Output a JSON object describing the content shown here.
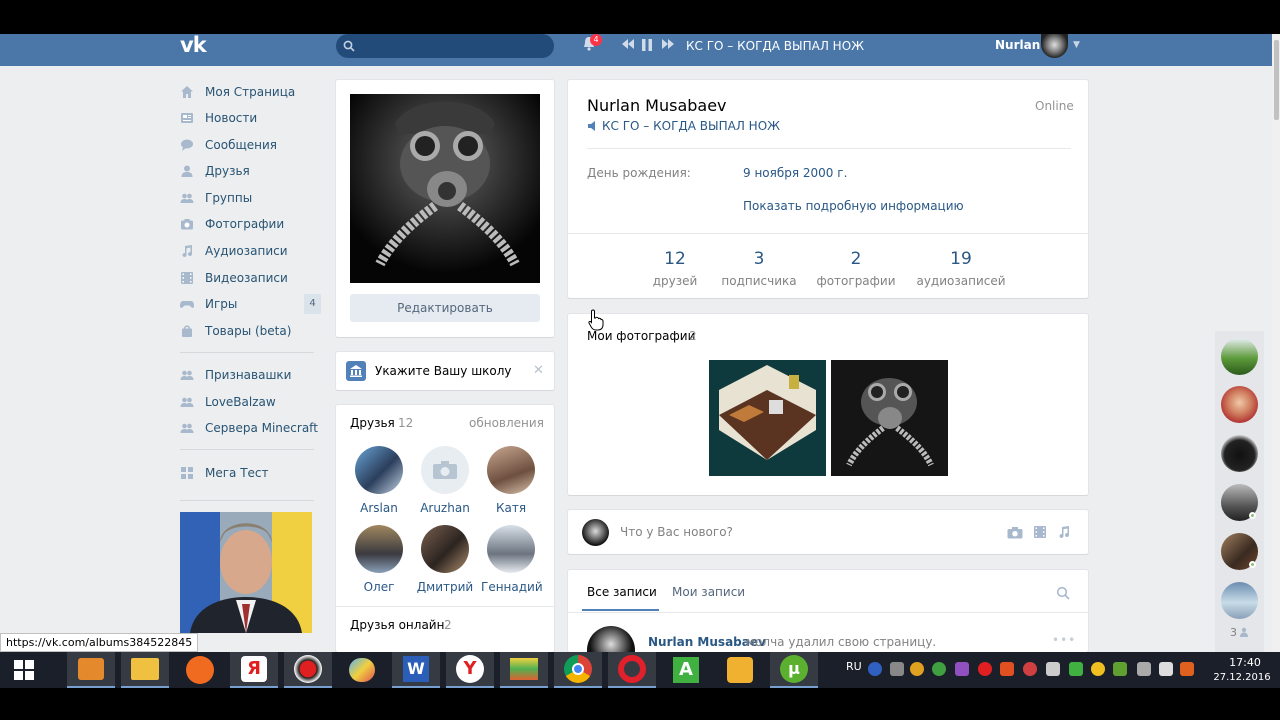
{
  "topbar": {
    "logo": "vk",
    "notification_count": "4",
    "now_playing": "КС ГО – КОГДА ВЫПАЛ НОЖ",
    "user_name": "Nurlan"
  },
  "sidebar": {
    "items": [
      {
        "label": "Моя Страница",
        "icon": "home-icon"
      },
      {
        "label": "Новости",
        "icon": "news-icon"
      },
      {
        "label": "Сообщения",
        "icon": "messages-icon"
      },
      {
        "label": "Друзья",
        "icon": "friends-icon"
      },
      {
        "label": "Группы",
        "icon": "groups-icon"
      },
      {
        "label": "Фотографии",
        "icon": "camera-icon"
      },
      {
        "label": "Аудиозаписи",
        "icon": "music-icon"
      },
      {
        "label": "Видеозаписи",
        "icon": "video-icon"
      },
      {
        "label": "Игры",
        "icon": "gamepad-icon",
        "count": "4"
      },
      {
        "label": "Товары (beta)",
        "icon": "bag-icon"
      }
    ],
    "groups": [
      {
        "label": "Признавашки"
      },
      {
        "label": "LoveBalzaw"
      },
      {
        "label": "Сервера Minecraft"
      }
    ],
    "apps": [
      {
        "label": "Мега Тест"
      }
    ]
  },
  "profile": {
    "edit_button": "Редактировать",
    "school_prompt": "Укажите Вашу школу",
    "name": "Nurlan Musabaev",
    "online": "Online",
    "status": "КС ГО – КОГДА ВЫПАЛ НОЖ",
    "birthday_label": "День рождения:",
    "birthday_value": "9 ноября 2000 г.",
    "more_info": "Показать подробную информацию",
    "counters": [
      {
        "n": "12",
        "l": "друзей"
      },
      {
        "n": "3",
        "l": "подписчика"
      },
      {
        "n": "2",
        "l": "фотографии"
      },
      {
        "n": "19",
        "l": "аудиозаписей"
      }
    ]
  },
  "friends": {
    "title": "Друзья",
    "count": "12",
    "updates": "обновления",
    "list": [
      {
        "name": "Arslan"
      },
      {
        "name": "Aruzhan"
      },
      {
        "name": "Катя"
      },
      {
        "name": "Олег"
      },
      {
        "name": "Дмитрий"
      },
      {
        "name": "Геннадий"
      }
    ],
    "online_title": "Друзья онлайн",
    "online_count": "2"
  },
  "photos": {
    "title": "Мои фотографии",
    "count": "2"
  },
  "composer": {
    "placeholder": "Что у Вас нового?"
  },
  "wall": {
    "tab_all": "Все записи",
    "tab_mine": "Мои записи",
    "post_author": "Nurlan Musabaev",
    "post_text": "молча удалил свою страницу."
  },
  "chat": {
    "more": "3"
  },
  "status_url": "https://vk.com/albums384522845",
  "taskbar": {
    "lang": "RU",
    "time": "17:40",
    "date": "27.12.2016"
  },
  "colors": {
    "header": "#4a76a8",
    "link": "#2a5885",
    "background": "#edeef0"
  }
}
